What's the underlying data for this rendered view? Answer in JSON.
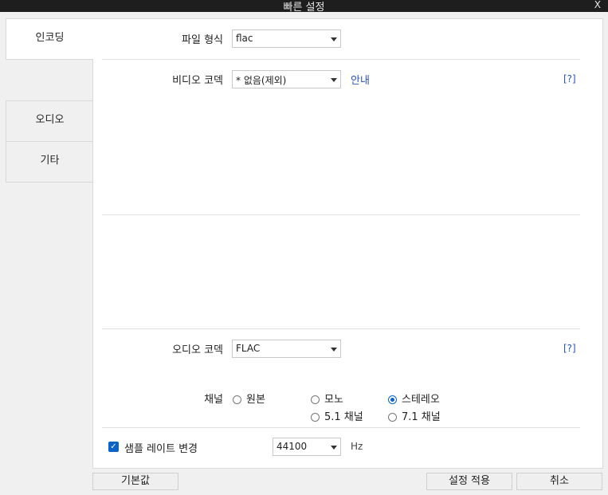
{
  "window": {
    "title": "빠른 설정",
    "close_label": "X"
  },
  "tabs": [
    {
      "label": "인코딩"
    },
    {
      "label": "오디오"
    },
    {
      "label": "기타"
    }
  ],
  "encoding": {
    "file_format": {
      "label": "파일 형식",
      "value": "flac"
    },
    "video_codec": {
      "label": "비디오 코덱",
      "value": "* 없음(제외)",
      "guide_link": "안내",
      "help": "[?]"
    },
    "audio_codec": {
      "label": "오디오 코덱",
      "value": "FLAC",
      "help": "[?]"
    },
    "channel": {
      "label": "채널",
      "options": [
        {
          "label": "원본",
          "selected": false
        },
        {
          "label": "모노",
          "selected": false
        },
        {
          "label": "스테레오",
          "selected": true
        },
        {
          "label": "5.1 채널",
          "selected": false
        },
        {
          "label": "7.1 채널",
          "selected": false
        }
      ]
    },
    "sample_rate": {
      "checkbox_label": "샘플 레이트 변경",
      "checked": true,
      "value": "44100",
      "unit": "Hz"
    }
  },
  "buttons": {
    "default": "기본값",
    "apply": "설정 적용",
    "cancel": "취소"
  },
  "colors": {
    "accent": "#0a64c8",
    "link": "#2a52be",
    "titlebar": "#1e1e1e"
  }
}
